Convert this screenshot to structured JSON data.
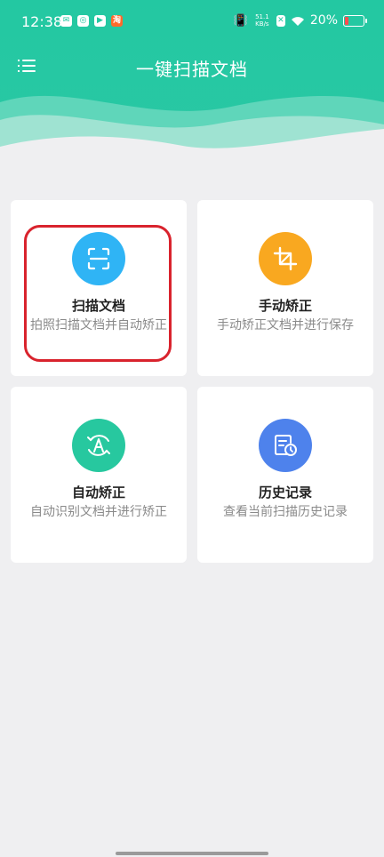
{
  "status_bar": {
    "time": "12:38",
    "net_speed_value": "51.1",
    "net_speed_unit": "KB/s",
    "battery_percent": "20%"
  },
  "header": {
    "title": "一键扫描文档",
    "color": "#23c8a2"
  },
  "cards": [
    {
      "label": "扫描文档",
      "desc": "拍照扫描文档并自动矫正",
      "icon": "scan-icon",
      "color": "#2fb4f5"
    },
    {
      "label": "手动矫正",
      "desc": "手动矫正文档并进行保存",
      "icon": "crop-icon",
      "color": "#f9a820"
    },
    {
      "label": "自动矫正",
      "desc": "自动识别文档并进行矫正",
      "icon": "auto-rotate-icon",
      "color": "#27c89f"
    },
    {
      "label": "历史记录",
      "desc": "查看当前扫描历史记录",
      "icon": "history-icon",
      "color": "#4e82ec"
    }
  ],
  "highlight_color": "#d9232d"
}
